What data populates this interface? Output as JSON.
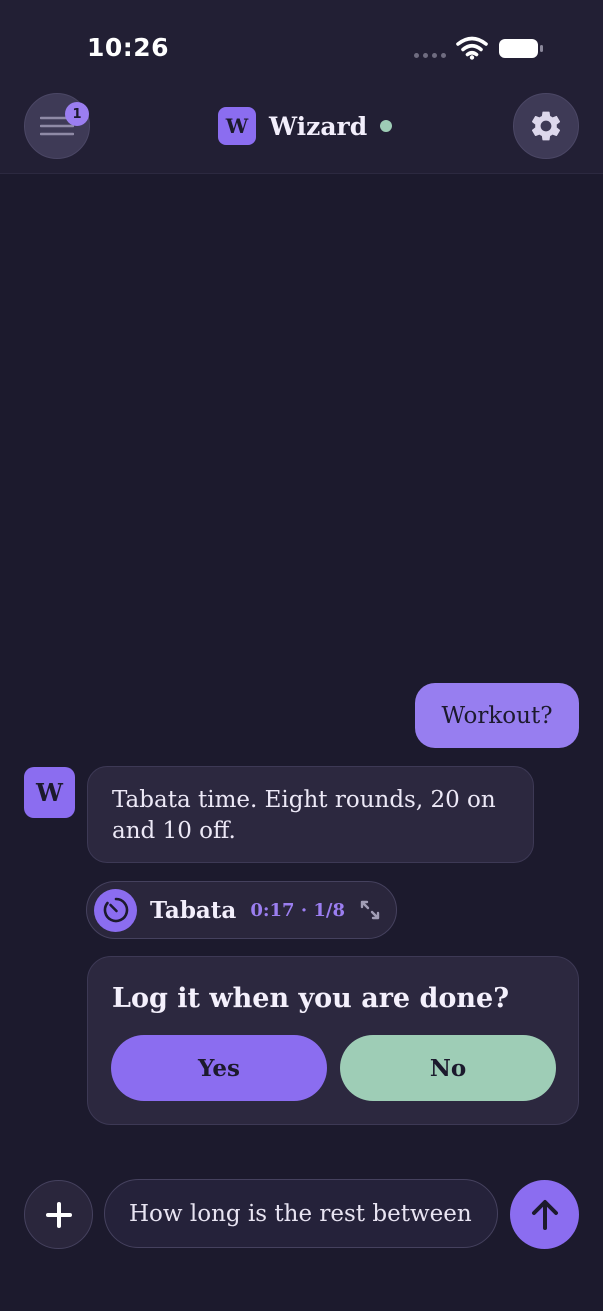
{
  "status_bar": {
    "time": "10:26",
    "icons": [
      "cellular-signal-icon",
      "wifi-icon",
      "battery-icon"
    ]
  },
  "header": {
    "menu_badge_count": "1",
    "brand_initial": "W",
    "title": "Wizard",
    "online_status_color": "#9ecdb6",
    "icons": [
      "menu-icon",
      "gear-icon"
    ]
  },
  "chat": {
    "messages": [
      {
        "role": "user",
        "text": "Workout?"
      },
      {
        "role": "assistant",
        "avatar_initial": "W",
        "text": "Tabata time. Eight rounds, 20 on and 10 off."
      }
    ],
    "timer": {
      "name": "Tabata",
      "progress": "0:17 · 1/8",
      "icons": [
        "timer-icon",
        "expand-icon"
      ]
    },
    "log_prompt": {
      "question": "Log it when you are done?",
      "yes_label": "Yes",
      "no_label": "No"
    }
  },
  "composer": {
    "value": "How long is the rest between",
    "icons": [
      "plus-icon",
      "send-arrow-up-icon"
    ]
  },
  "colors": {
    "background": "#1c1a2d",
    "accent": "#8b6df0",
    "user_bubble": "#977ef0",
    "secondary": "#9ecdb6"
  }
}
